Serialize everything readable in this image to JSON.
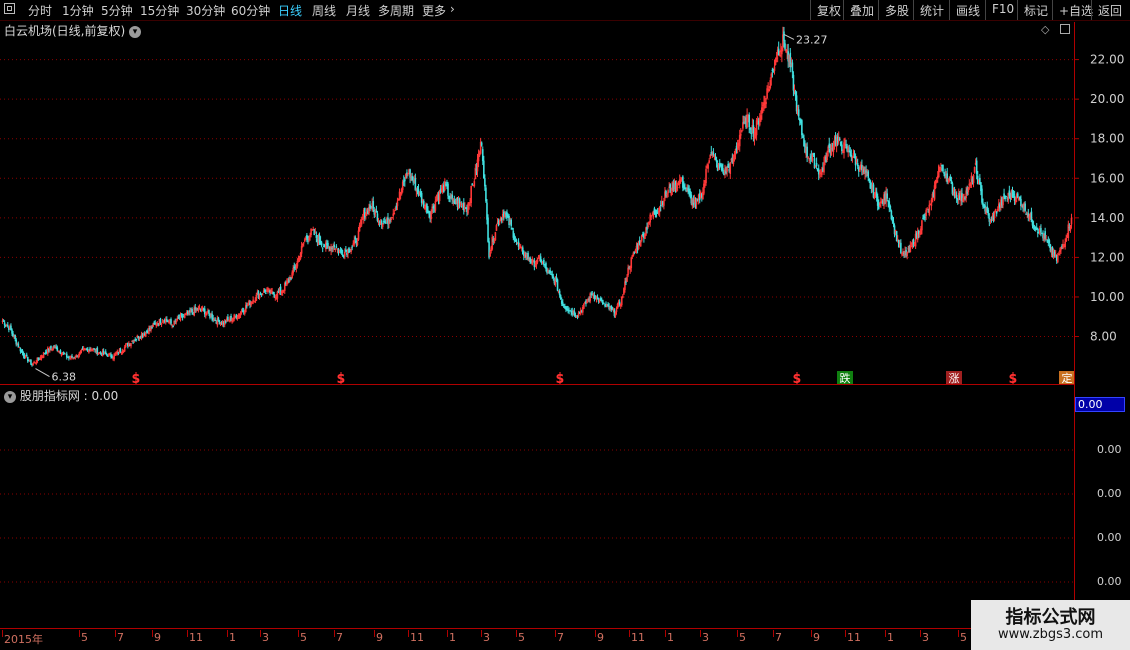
{
  "toolbar": {
    "periods": [
      "分时",
      "1分钟",
      "5分钟",
      "15分钟",
      "30分钟",
      "60分钟",
      "日线",
      "周线",
      "月线",
      "多周期",
      "更多"
    ],
    "active_period": "日线",
    "right_buttons": [
      "复权",
      "叠加",
      "多股",
      "统计",
      "画线",
      "F10",
      "标记",
      "+自选",
      "返回"
    ]
  },
  "main_panel": {
    "title": "白云机场(日线,前复权)"
  },
  "sub_panel": {
    "title": "股朋指标网 : 0.00",
    "value_box": "0.00",
    "ticks": [
      "0.00",
      "0.00",
      "0.00",
      "0.00"
    ]
  },
  "watermark": {
    "title": "指标公式网",
    "url": "www.zbgs3.com"
  },
  "colors": {
    "up": "#ff3838",
    "down": "#40e0e0",
    "grid": "#8a0000",
    "axis": "#b00000",
    "marker_s": "#ff3030",
    "marker_fall_bg": "#108010",
    "marker_rise_bg": "#a02020",
    "marker_ding_bg": "#c87020"
  },
  "chart_data": {
    "type": "candlestick",
    "y_ticks": [
      8.0,
      10.0,
      12.0,
      14.0,
      16.0,
      18.0,
      20.0,
      22.0
    ],
    "y_tick_labels": [
      "8.00",
      "10.00",
      "12.00",
      "14.00",
      "16.00",
      "18.00",
      "20.00",
      "22.00"
    ],
    "ylim": [
      5.6,
      23.9
    ],
    "annotations": [
      {
        "label": "6.38",
        "value": 6.38,
        "position": "low"
      },
      {
        "label": "23.27",
        "value": 23.27,
        "position": "high"
      }
    ],
    "x_labels": [
      "2015年",
      "5",
      "7",
      "9",
      "11",
      "1",
      "3",
      "5",
      "7",
      "9",
      "11",
      "1",
      "3",
      "5",
      "7",
      "9",
      "11",
      "1",
      "3",
      "5",
      "7",
      "9",
      "11",
      "1",
      "3",
      "5"
    ],
    "close_series": [
      8.8,
      8.4,
      7.6,
      7.0,
      6.6,
      6.9,
      7.3,
      7.5,
      7.2,
      6.9,
      7.0,
      7.3,
      7.4,
      7.2,
      7.1,
      7.0,
      7.3,
      7.6,
      7.9,
      8.1,
      8.4,
      8.7,
      8.9,
      8.6,
      8.9,
      9.1,
      9.3,
      9.4,
      9.1,
      8.8,
      8.7,
      8.9,
      9.1,
      9.5,
      9.9,
      10.2,
      10.3,
      10.1,
      10.4,
      10.9,
      11.8,
      12.9,
      13.3,
      12.8,
      12.5,
      12.6,
      12.2,
      12.4,
      12.8,
      14.2,
      14.6,
      14.0,
      13.7,
      14.3,
      15.3,
      16.4,
      15.6,
      14.8,
      14.2,
      15.1,
      15.6,
      14.8,
      14.7,
      14.5,
      16.0,
      17.9,
      12.2,
      13.6,
      14.3,
      13.5,
      12.5,
      12.1,
      11.7,
      11.9,
      11.2,
      10.8,
      9.6,
      9.3,
      9.1,
      9.6,
      10.2,
      9.8,
      9.5,
      9.2,
      9.9,
      11.6,
      12.5,
      13.2,
      14.1,
      14.5,
      15.2,
      15.6,
      15.9,
      15.2,
      14.6,
      15.4,
      17.4,
      16.6,
      16.3,
      16.8,
      18.2,
      19.0,
      18.3,
      19.5,
      20.7,
      22.3,
      23.0,
      21.4,
      19.0,
      17.3,
      16.9,
      16.2,
      17.4,
      17.9,
      17.6,
      17.3,
      16.7,
      16.2,
      15.4,
      14.6,
      15.2,
      13.4,
      12.1,
      12.3,
      13.1,
      14.0,
      14.7,
      16.6,
      16.2,
      15.3,
      15.0,
      15.4,
      16.5,
      14.7,
      13.8,
      14.5,
      15.0,
      15.2,
      14.9,
      14.3,
      13.6,
      13.2,
      12.5,
      11.9,
      12.8,
      14.0
    ],
    "markers": [
      {
        "label": "S",
        "kind": "s"
      },
      {
        "label": "S",
        "kind": "s"
      },
      {
        "label": "S",
        "kind": "s"
      },
      {
        "label": "S",
        "kind": "s"
      },
      {
        "label": "跌",
        "kind": "fall"
      },
      {
        "label": "涨",
        "kind": "rise"
      },
      {
        "label": "S",
        "kind": "s"
      },
      {
        "label": "定",
        "kind": "ding"
      }
    ]
  }
}
